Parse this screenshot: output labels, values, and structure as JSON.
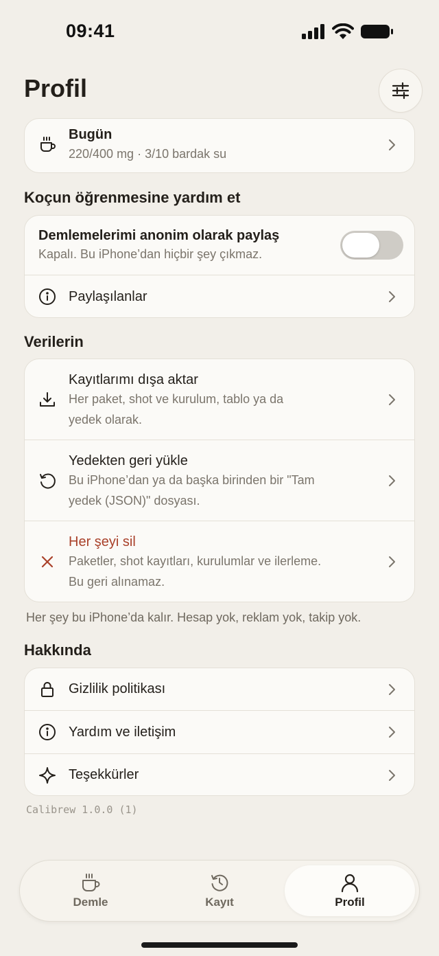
{
  "status_bar": {
    "time": "09:41"
  },
  "header": {
    "title": "Profil"
  },
  "today_card": {
    "title": "Bugün",
    "subtitle": "220/400 mg · 3/10 bardak su"
  },
  "coach_section": {
    "title": "Koçun öğrenmesine yardım et",
    "share_toggle": {
      "title": "Demlemelerimi anonim olarak paylaş",
      "subtitle": "Kapalı. Bu iPhone’dan hiçbir şey çıkmaz.",
      "enabled": false
    },
    "shared_link": {
      "label": "Paylaşılanlar"
    }
  },
  "data_section": {
    "title": "Verilerin",
    "export": {
      "title": "Kayıtlarımı dışa aktar",
      "subtitle_line1": "Her paket, shot ve kurulum, tablo ya da",
      "subtitle_line2": "yedek olarak."
    },
    "restore": {
      "title": "Yedekten geri yükle",
      "subtitle_line1": "Bu iPhone’dan ya da başka birinden bir \"Tam",
      "subtitle_line2": "yedek (JSON)\" dosyası."
    },
    "delete_all": {
      "title": "Her şeyi sil",
      "subtitle_line1": "Paketler, shot kayıtları, kurulumlar ve ilerleme.",
      "subtitle_line2": "Bu geri alınamaz.",
      "color": "#a9412a"
    },
    "footnote": "Her şey bu iPhone’da kalır. Hesap yok, reklam yok, takip yok."
  },
  "about_section": {
    "title": "Hakkında",
    "items": [
      {
        "label": "Gizlilik politikası",
        "icon": "lock-icon"
      },
      {
        "label": "Yardım ve iletişim",
        "icon": "info-icon"
      },
      {
        "label": "Teşekkürler",
        "icon": "sparkle-icon"
      }
    ]
  },
  "version": "Calibrew 1.0.0 (1)",
  "tab_bar": {
    "tabs": [
      {
        "label": "Demle",
        "icon": "cup-icon",
        "active": false
      },
      {
        "label": "Kayıt",
        "icon": "history-icon",
        "active": false
      },
      {
        "label": "Profil",
        "icon": "person-icon",
        "active": true
      }
    ]
  },
  "colors": {
    "background": "#f2efe9",
    "card": "#fbfaf7",
    "text": "#231f1a",
    "muted": "#7b756c",
    "destructive": "#a9412a"
  }
}
